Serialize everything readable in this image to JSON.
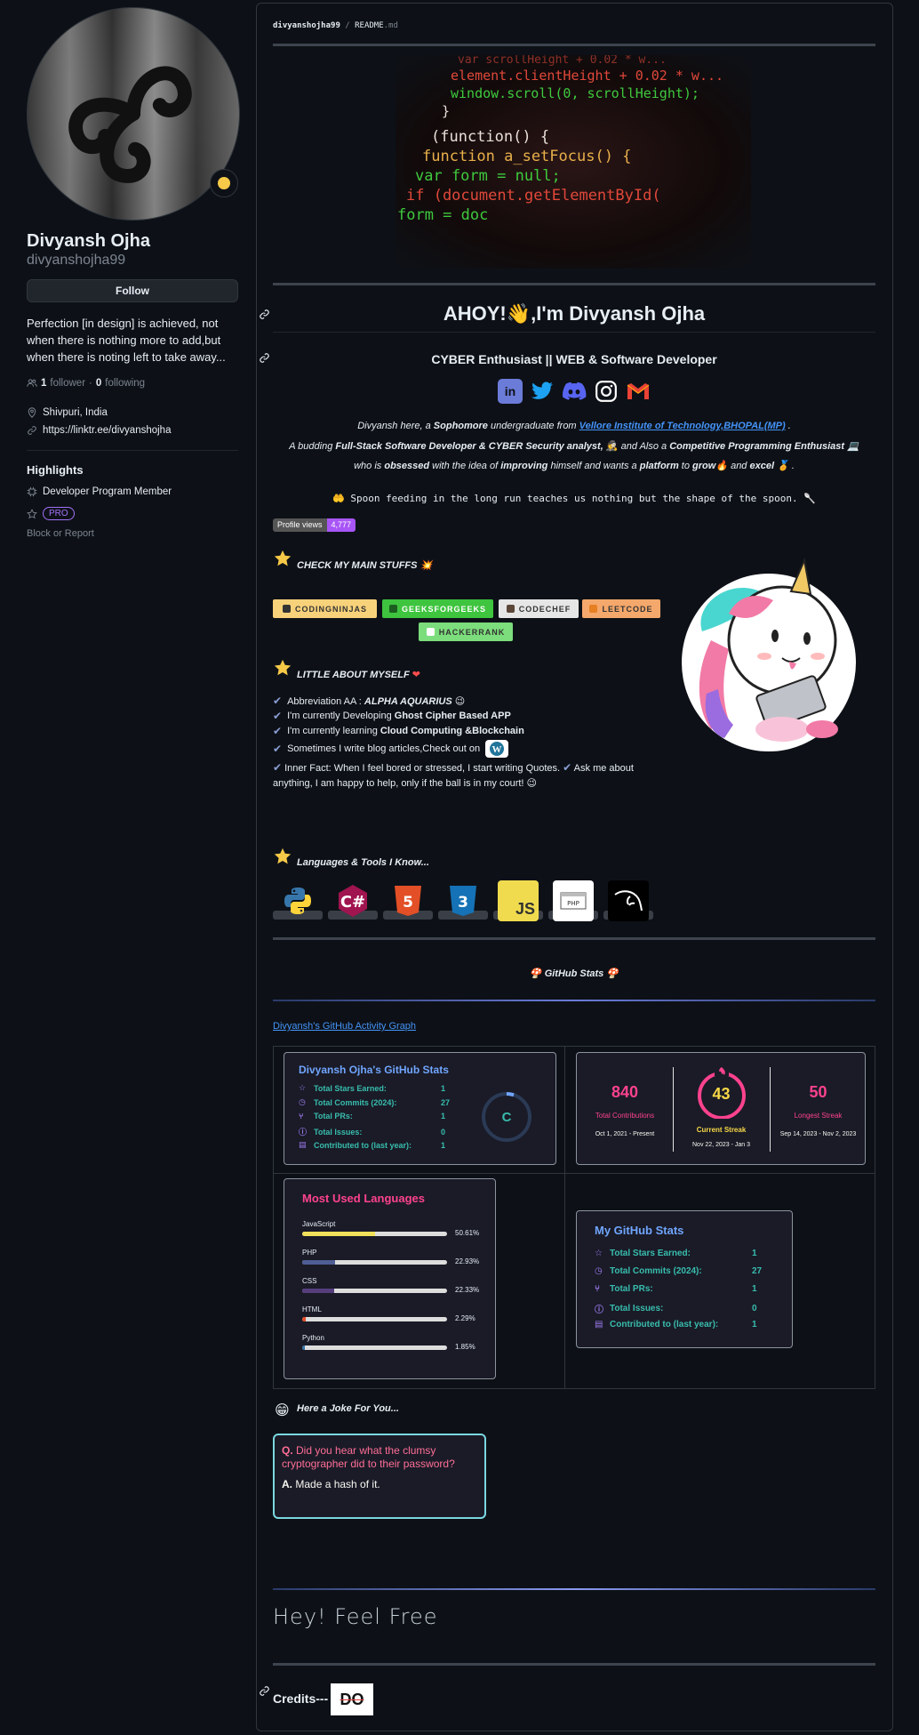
{
  "profile": {
    "name": "Divyansh Ojha",
    "username": "divyanshojha99",
    "follow_label": "Follow",
    "bio": "Perfection [in design] is achieved, not when there is nothing more to add,but when there is noting left to take away...",
    "followers_count": "1",
    "followers_label": "follower",
    "following_count": "0",
    "following_label": "following",
    "location": "Shivpuri, India",
    "website": "https://linktr.ee/divyanshojha",
    "highlights_title": "Highlights",
    "highlight_program": "Developer Program Member",
    "pro_label": "PRO",
    "block_report": "Block or Report"
  },
  "readme": {
    "path_user": "divyanshojha99",
    "path_sep": " / ",
    "path_file": "README",
    "path_ext": ".md",
    "code_lines": [
      "var scrollHeight + 0.02 * w...",
      "element.clientHeight + 0.02 * w...",
      "window.scroll(0, scrollHeight);",
      "}",
      "(function() {",
      "function a_setFocus() {",
      "var form = null;",
      "if (document.getElementById(",
      "form = doc"
    ],
    "greeting": "AHOY!👋,I'm Divyansh Ojha",
    "subtitle": "CYBER Enthusiast || WEB & Software Developer",
    "intro_1a": "Divyansh here, a ",
    "intro_1b": "Sophomore",
    "intro_1c": " undergraduate from ",
    "intro_1d": "Vellore Institute of Technology,BHOPAL(MP)",
    "intro_1e": " .",
    "intro_2a": "A budding ",
    "intro_2b": "Full-Stack Software Developer & CYBER Security analyst,",
    "intro_2c": "  and Also a ",
    "intro_2d": "Competitive Programming Enthusiast",
    "intro_3a": "who is ",
    "intro_3b": "obsessed",
    "intro_3c": " with the idea of ",
    "intro_3d": "improving",
    "intro_3e": " himself and wants a ",
    "intro_3f": "platform",
    "intro_3g": " to ",
    "intro_3h": "grow",
    "intro_3i": " and ",
    "intro_3j": "excel",
    "quote": "Spoon feeding in the long run teaches us nothing but the shape of the spoon.",
    "views_label": "Profile views",
    "views_count": "4,777",
    "main_stuffs_title": "CHECK MY MAIN STUFFS",
    "badges": [
      "CODINGNINJAS",
      "GEEKSFORGEEKS",
      "CODECHEF",
      "LEETCODE",
      "HACKERRANK"
    ],
    "about_title": "LITTLE ABOUT MYSELF",
    "about_1a": "Abbreviation AA : ",
    "about_1b": "ALPHA AQUARIUS",
    "about_2a": "I'm currently Developing ",
    "about_2b": "Ghost Cipher Based APP",
    "about_3a": "I'm currently learning ",
    "about_3b": "Cloud Computing &Blockchain",
    "about_4": "Sometimes I write blog articles,Check out on",
    "about_5a": "Inner Fact: When I feel bored or stressed, I start writing Quotes.",
    "about_5b": "Ask me about anything, I am happy to help, only if the ball is in my court!",
    "tools_title": "Languages & Tools I Know...",
    "stats_title": "GitHub Stats",
    "activity_alt": "Divyansh's GitHub Activity Graph",
    "joke_title": "Here a Joke For You...",
    "joke_q_label": "Q.",
    "joke_q": "Did you hear what the clumsy cryptographer did to their password?",
    "joke_a_label": "A.",
    "joke_a": "Made a hash of it.",
    "free_text": "Hey! Feel Free",
    "credits_label": "Credits---",
    "credits_logo": "DO"
  },
  "stats_card": {
    "title": "Divyansh Ojha's GitHub Stats",
    "rank": "C",
    "rows": [
      {
        "label": "Total Stars Earned:",
        "value": "1"
      },
      {
        "label": "Total Commits (2024):",
        "value": "27"
      },
      {
        "label": "Total PRs:",
        "value": "1"
      },
      {
        "label": "Total Issues:",
        "value": "0"
      },
      {
        "label": "Contributed to (last year):",
        "value": "1"
      }
    ]
  },
  "streak_card": {
    "total": "840",
    "total_label": "Total Contributions",
    "total_range": "Oct 1, 2021 - Present",
    "current": "43",
    "current_label": "Current Streak",
    "current_range": "Nov 22, 2023 - Jan 3",
    "longest": "50",
    "longest_label": "Longest Streak",
    "longest_range": "Sep 14, 2023 - Nov 2, 2023"
  },
  "langs_card": {
    "title": "Most Used Languages",
    "langs": [
      {
        "name": "JavaScript",
        "pct": "50.61%",
        "value": 50.61,
        "color": "#f1e05a"
      },
      {
        "name": "PHP",
        "pct": "22.93%",
        "value": 22.93,
        "color": "#4f5d95"
      },
      {
        "name": "CSS",
        "pct": "22.33%",
        "value": 22.33,
        "color": "#563d7c"
      },
      {
        "name": "HTML",
        "pct": "2.29%",
        "value": 2.29,
        "color": "#e34c26"
      },
      {
        "name": "Python",
        "pct": "1.85%",
        "value": 1.85,
        "color": "#3572a5"
      }
    ]
  },
  "my_stats_card": {
    "title": "My GitHub Stats",
    "rows": [
      {
        "label": "Total Stars Earned:",
        "value": "1"
      },
      {
        "label": "Total Commits (2024):",
        "value": "27"
      },
      {
        "label": "Total PRs:",
        "value": "1"
      },
      {
        "label": "Total Issues:",
        "value": "0"
      },
      {
        "label": "Contributed to (last year):",
        "value": "1"
      }
    ]
  },
  "tools": [
    "python-icon",
    "csharp-icon",
    "html5-icon",
    "css3-icon",
    "javascript-icon",
    "php-icon",
    "kali-linux-icon"
  ],
  "colors": {
    "bg": "#0d1117",
    "border": "#30363d",
    "link": "#4493f8",
    "teal": "#38bdae",
    "pink": "#fe428e",
    "streak_orange": "#f7c948"
  }
}
